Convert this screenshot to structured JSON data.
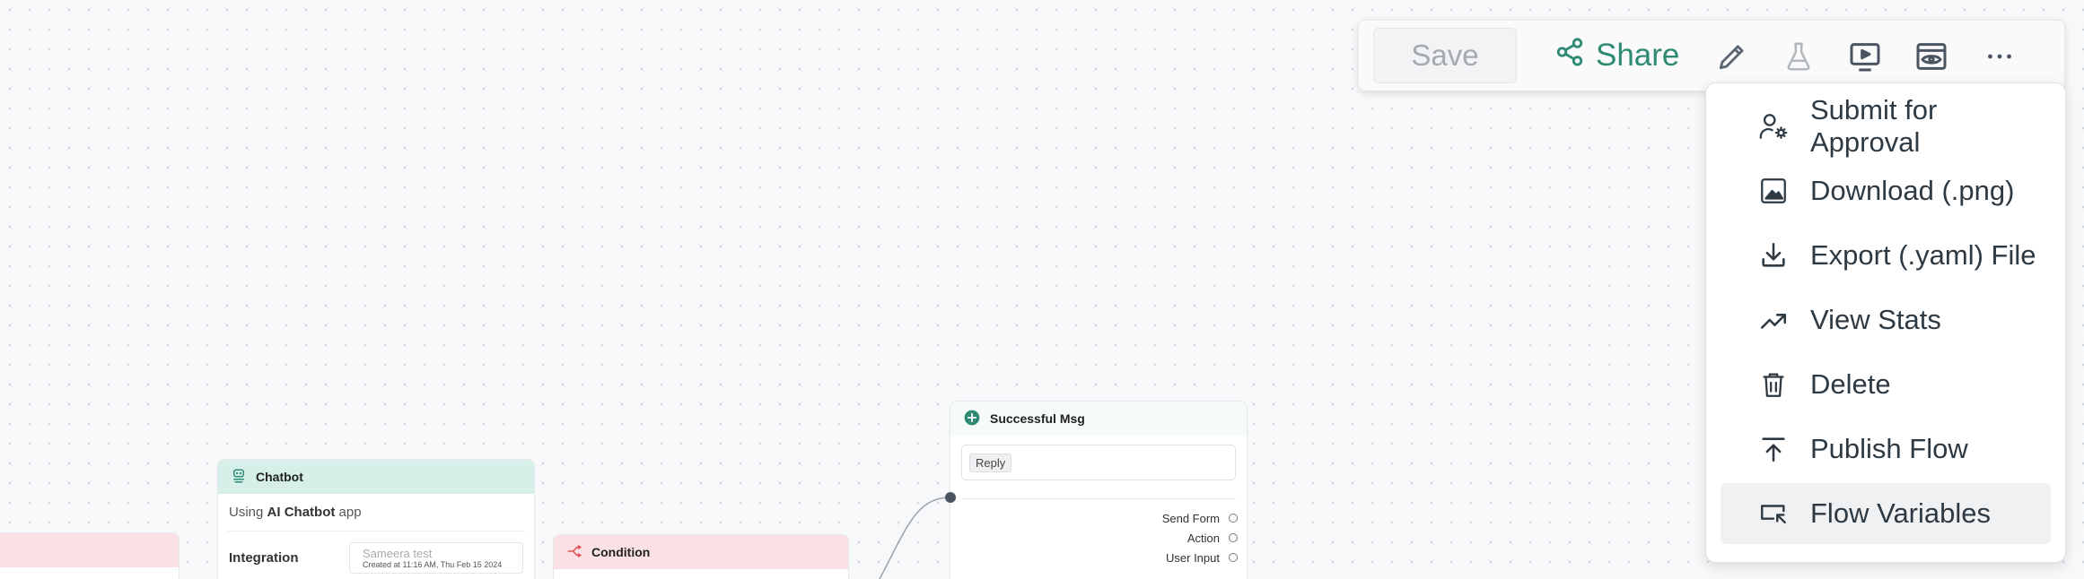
{
  "toolbar": {
    "save_label": "Save",
    "share_label": "Share"
  },
  "menu": {
    "items": [
      {
        "label": "Submit for Approval",
        "icon": "user-gear-icon"
      },
      {
        "label": "Download (.png)",
        "icon": "image-icon"
      },
      {
        "label": "Export (.yaml) File",
        "icon": "download-icon"
      },
      {
        "label": "View Stats",
        "icon": "trending-up-icon"
      },
      {
        "label": "Delete",
        "icon": "trash-icon"
      },
      {
        "label": "Publish Flow",
        "icon": "upload-icon"
      },
      {
        "label": "Flow Variables",
        "icon": "variables-icon"
      }
    ]
  },
  "nodes": {
    "chatbot": {
      "title": "Chatbot",
      "using_prefix": "Using",
      "using_app": "AI Chatbot",
      "using_suffix": "app",
      "integration_label": "Integration",
      "integration_name": "Sameera test",
      "integration_date": "Created at 11:16 AM, Thu Feb 15 2024"
    },
    "condition": {
      "title": "Condition"
    },
    "success": {
      "title": "Successful Msg",
      "reply_chip": "Reply",
      "outputs": [
        "Send Form",
        "Action",
        "User Input"
      ]
    }
  },
  "colors": {
    "accent": "#2f8a73",
    "chatbot_header": "#d7efe9",
    "condition_header": "#fbe1e6"
  }
}
